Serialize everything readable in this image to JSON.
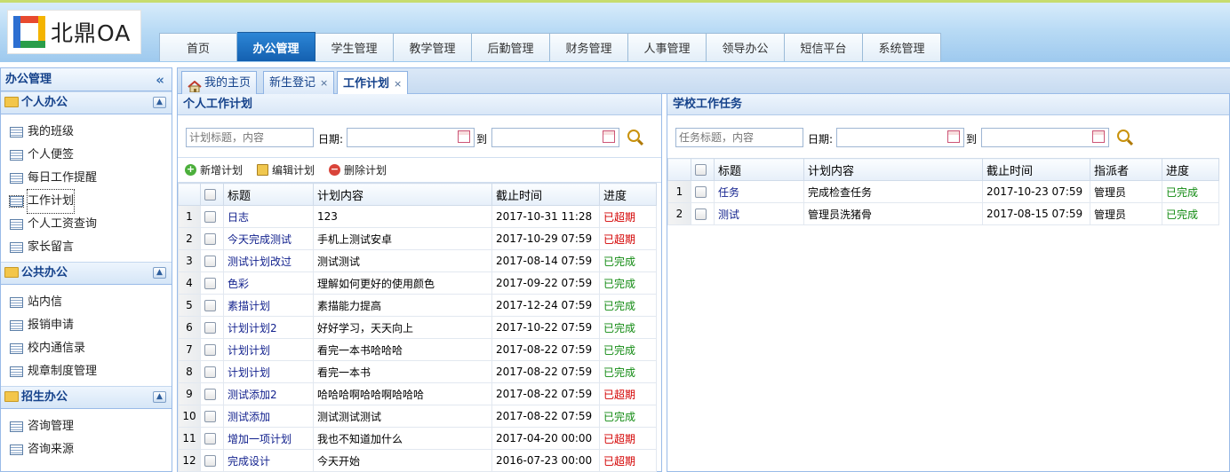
{
  "app": {
    "logo_text": "北鼎OA"
  },
  "nav": {
    "items": [
      "首页",
      "办公管理",
      "学生管理",
      "教学管理",
      "后勤管理",
      "财务管理",
      "人事管理",
      "领导办公",
      "短信平台",
      "系统管理"
    ],
    "active_index": 1
  },
  "sidebar": {
    "title": "办公管理",
    "groups": [
      {
        "title": "个人办公",
        "items": [
          "我的班级",
          "个人便签",
          "每日工作提醒",
          "工作计划",
          "个人工资查询",
          "家长留言"
        ]
      },
      {
        "title": "公共办公",
        "items": [
          "站内信",
          "报销申请",
          "校内通信录",
          "规章制度管理"
        ]
      },
      {
        "title": "招生办公",
        "items": [
          "咨询管理",
          "咨询来源"
        ]
      }
    ],
    "current_item": "工作计划"
  },
  "tabs": [
    {
      "label": "我的主页"
    },
    {
      "label": "新生登记"
    },
    {
      "label": "工作计划"
    }
  ],
  "left_panel": {
    "title": "个人工作计划",
    "search_placeholder": "计划标题，内容",
    "date_label": "日期:",
    "to_label": "到",
    "toolbar": {
      "add": "新增计划",
      "edit": "编辑计划",
      "delete": "删除计划"
    },
    "columns": [
      "标题",
      "计划内容",
      "截止时间",
      "进度"
    ],
    "rows": [
      {
        "n": "1",
        "title": "日志",
        "content": "123",
        "deadline": "2017-10-31 11:28",
        "status": "已超期"
      },
      {
        "n": "2",
        "title": "今天完成测试",
        "content": "手机上测试安卓",
        "deadline": "2017-10-29 07:59",
        "status": "已超期"
      },
      {
        "n": "3",
        "title": "测试计划改过",
        "content": "测试测试",
        "deadline": "2017-08-14 07:59",
        "status": "已完成"
      },
      {
        "n": "4",
        "title": "色彩",
        "content": "理解如何更好的使用颜色",
        "deadline": "2017-09-22 07:59",
        "status": "已完成"
      },
      {
        "n": "5",
        "title": "素描计划",
        "content": "素描能力提高",
        "deadline": "2017-12-24 07:59",
        "status": "已完成"
      },
      {
        "n": "6",
        "title": "计划计划2",
        "content": "好好学习，天天向上",
        "deadline": "2017-10-22 07:59",
        "status": "已完成"
      },
      {
        "n": "7",
        "title": "计划计划",
        "content": "看完一本书哈哈哈",
        "deadline": "2017-08-22 07:59",
        "status": "已完成"
      },
      {
        "n": "8",
        "title": "计划计划",
        "content": "看完一本书",
        "deadline": "2017-08-22 07:59",
        "status": "已完成"
      },
      {
        "n": "9",
        "title": "测试添加2",
        "content": "哈哈哈啊哈哈啊哈哈哈",
        "deadline": "2017-08-22 07:59",
        "status": "已超期"
      },
      {
        "n": "10",
        "title": "测试添加",
        "content": "测试测试测试",
        "deadline": "2017-08-22 07:59",
        "status": "已完成"
      },
      {
        "n": "11",
        "title": "增加一项计划",
        "content": "我也不知道加什么",
        "deadline": "2017-04-20 00:00",
        "status": "已超期"
      },
      {
        "n": "12",
        "title": "完成设计",
        "content": "今天开始",
        "deadline": "2016-07-23 00:00",
        "status": "已超期"
      }
    ]
  },
  "right_panel": {
    "title": "学校工作任务",
    "search_placeholder": "任务标题，内容",
    "date_label": "日期:",
    "to_label": "到",
    "columns": [
      "标题",
      "计划内容",
      "截止时间",
      "指派者",
      "进度"
    ],
    "rows": [
      {
        "n": "1",
        "title": "任务",
        "content": "完成检查任务",
        "deadline": "2017-10-23 07:59",
        "assigner": "管理员",
        "status": "已完成"
      },
      {
        "n": "2",
        "title": "测试",
        "content": "管理员洗猪骨",
        "deadline": "2017-08-15 07:59",
        "assigner": "管理员",
        "status": "已完成"
      }
    ]
  },
  "colors": {
    "overdue": "#d30000",
    "done": "#118a11",
    "title_link": "#13228e",
    "nav_active": "#1a6bc0"
  }
}
